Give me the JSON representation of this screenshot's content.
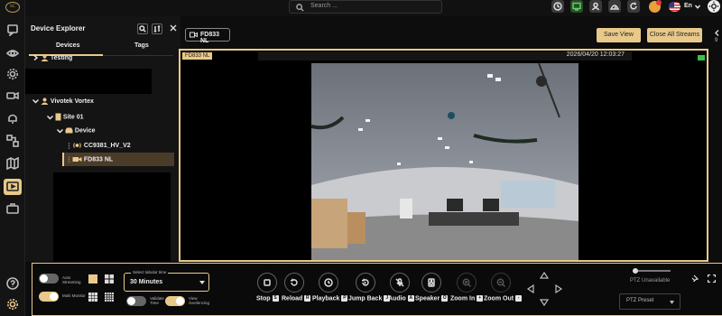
{
  "app": {
    "logo_text": "SC"
  },
  "search": {
    "placeholder": "Search ..."
  },
  "header": {
    "language": "En"
  },
  "explorer": {
    "title": "Device Explorer",
    "tabs": [
      {
        "label": "Devices"
      },
      {
        "label": "Tags"
      }
    ],
    "tree": [
      {
        "label": "Testing"
      },
      {
        "label": "Vivotek Vortex"
      },
      {
        "label": "Site 01"
      },
      {
        "label": "Device"
      },
      {
        "label": "CC9381_HV_V2"
      },
      {
        "label": "FD833 NL"
      }
    ]
  },
  "main": {
    "camera_tab": "FD833 NL",
    "save_view": "Save View",
    "close_all": "Close All Streams",
    "edge_label": "9"
  },
  "viewer": {
    "camera_label": "FD833 NL",
    "timestamp": "2026/04/20 12:03:27"
  },
  "controls": {
    "auto_streaming": "Auto Streaming",
    "multi_monitor": "Multi Monitor",
    "select_label": "Select tabular time",
    "select_value": "30 Minutes",
    "validate_time": "Validate Time",
    "view_geofencing": "View Geofencing",
    "buttons": [
      {
        "label": "Stop",
        "key": "S"
      },
      {
        "label": "Reload",
        "key": "R"
      },
      {
        "label": "Playback",
        "key": "P"
      },
      {
        "label": "Jump Back",
        "key": "J"
      },
      {
        "label": "Audio",
        "key": "A"
      },
      {
        "label": "Speaker",
        "key": "O"
      },
      {
        "label": "Zoom In",
        "key": "+"
      },
      {
        "label": "Zoom Out",
        "key": "-"
      }
    ],
    "ptz_unavailable": "PTZ Unavailable",
    "ptz_preset": "PTZ Preset"
  },
  "colors": {
    "accent": "#e9c98a",
    "background": "#0d0d0d",
    "live": "#37c24a"
  }
}
